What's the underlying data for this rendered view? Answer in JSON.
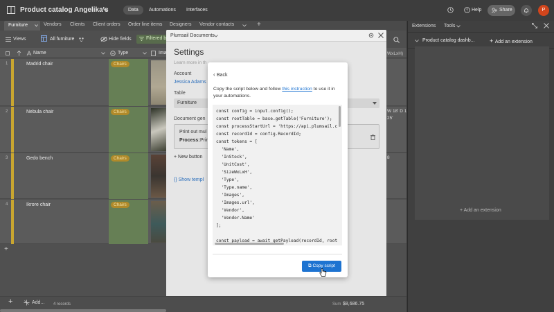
{
  "app": {
    "base_title": "Product catalog Angelika's",
    "nav": [
      "Data",
      "Automations",
      "Interfaces"
    ],
    "help": "Help",
    "share": "Share",
    "avatar_letter": "P"
  },
  "tables": [
    "Furniture",
    "Vendors",
    "Clients",
    "Client orders",
    "Order line items",
    "Designers",
    "Vendor contacts"
  ],
  "toolbar": {
    "views": "Views",
    "view_name": "All furniture",
    "hide_fields": "Hide fields",
    "filtered": "Filtered b"
  },
  "columns": [
    "Name",
    "Type",
    "Imag"
  ],
  "rows": [
    {
      "num": "1",
      "name": "Madrid chair",
      "type": "Chairs"
    },
    {
      "num": "2",
      "name": "Nebula chair",
      "type": "Chairs"
    },
    {
      "num": "3",
      "name": "Gedo bench",
      "type": "Chairs"
    },
    {
      "num": "4",
      "name": "Ikrore chair",
      "type": "Chairs"
    }
  ],
  "grid_footer": {
    "add": "Add...",
    "records": "4 records",
    "sum": "Sum",
    "sum_value": "$8,686.75"
  },
  "right_snippets": {
    "col": "WxLxH)",
    "size1": "W 18' D 1",
    "size2": "25'",
    "size3": "8"
  },
  "extensions": {
    "tab1": "Extensions",
    "tab2": "Tools",
    "title": "Product catalog dashb...",
    "add": "Add an extension",
    "add_center": "Add an extension"
  },
  "modal": {
    "title": "Plumsail Documents",
    "heading": "Settings",
    "learn": "Learn more in th",
    "account_label": "Account",
    "account_value": "Jessica Adams",
    "table_label": "Table",
    "table_value": "Furniture",
    "docgen_label": "Document gen",
    "process_line1": "Print out mul",
    "process_label": "Process:",
    "process_value": "Print",
    "new_button": "New button",
    "show_template": "Show templ"
  },
  "inner": {
    "back": "Back",
    "instr_pre": "Copy the script below and follow ",
    "instr_link": "this instruction",
    "instr_post": " to use it in",
    "instr_line2": "your automations.",
    "code": [
      "const config = input.config();",
      "const rootTable = base.getTable('Furniture');",
      "const processStartUrl = 'https://api.plumsail.c",
      "const recordId = config.RecordId;",
      "const tokens = [",
      "  'Name',",
      "  'InStock',",
      "  'UnitCost',",
      "  'SizeWxLxH',",
      "  'Type',",
      "  'Type.name',",
      "  'Images',",
      "  'Images.url',",
      "  'Vendor',",
      "  'Vendor.Name'",
      "];",
      "",
      "const payload = await getPayload(recordId, root"
    ],
    "copy_button": "Copy script"
  },
  "colors": {
    "accent": "#1d73d1",
    "chip": "#b08a2a",
    "row_bar": "#c9a630"
  }
}
